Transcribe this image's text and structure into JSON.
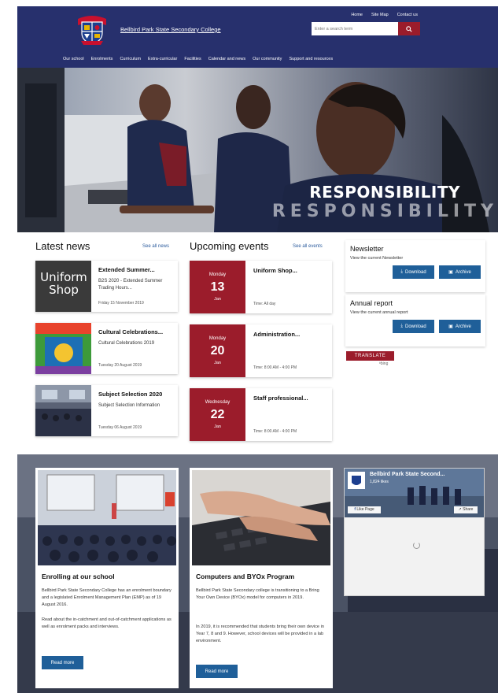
{
  "header": {
    "school_name": "Bellbird Park State Secondary College",
    "top_links": [
      "Home",
      "Site Map",
      "Contact us"
    ],
    "search_placeholder": "Enter a search term",
    "nav": [
      "Our school",
      "Enrolments",
      "Curriculum",
      "Extra-curricular",
      "Facilities",
      "Calendar and news",
      "Our community",
      "Support and resources"
    ]
  },
  "hero": {
    "headline": "RESPONSIBILITY",
    "headline_shadow": "RESPONSIBILITY"
  },
  "news": {
    "title": "Latest news",
    "see_all": "See all news",
    "items": [
      {
        "title": "Extended Summer...",
        "desc": "B2S 2020 - Extended Summer Trading Hours...",
        "date": "Friday 15 November 2019",
        "thumb_text": "Uniform Shop"
      },
      {
        "title": "Cultural Celebrations...",
        "desc": "Cultural Celebrations 2019",
        "date": "Tuesday 20 August 2019"
      },
      {
        "title": "Subject Selection 2020",
        "desc": "Subject Selection Information",
        "date": "Tuesday 06 August 2019"
      }
    ]
  },
  "events": {
    "title": "Upcoming events",
    "see_all": "See all events",
    "items": [
      {
        "day": "Monday",
        "num": "13",
        "month": "Jan",
        "title": "Uniform Shop...",
        "time": "Time: All day"
      },
      {
        "day": "Monday",
        "num": "20",
        "month": "Jan",
        "title": "Administration...",
        "time": "Time: 8:00 AM - 4:00 PM"
      },
      {
        "day": "Wednesday",
        "num": "22",
        "month": "Jan",
        "title": "Staff professional...",
        "time": "Time: 8:00 AM - 4:00 PM"
      }
    ]
  },
  "newsletter": {
    "title": "Newsletter",
    "desc": "View the current Newsletter",
    "download": "Download",
    "archive": "Archive"
  },
  "annual_report": {
    "title": "Annual report",
    "desc": "View the current annual report",
    "download": "Download",
    "archive": "Archive"
  },
  "translate": {
    "label": "TRANSLATE",
    "by": "bing"
  },
  "promos": [
    {
      "title": "Enrolling at our school",
      "p1": "Bellbird Park State Secondary College has an enrolment boundary and a legislated Enrolment Management Plan (EMP) as of 19 August 2016.",
      "p2": "Read about the in-catchment and out-of-catchment applications as well as enrolment packs and interviews.",
      "button": "Read more"
    },
    {
      "title": "Computers and BYOx Program",
      "p1": "Bellbird Park State Secondary college is transitioning to a Bring Your Own Device (BYOx) model for computers in 2019.",
      "p2": "In 2019, it is recommended that students bring their own device in Year 7, 8 and 9. However, school devices will be provided in a lab environment.",
      "button": "Read more"
    }
  ],
  "facebook": {
    "page_name": "Bellbird Park State Second...",
    "likes": "1,824 likes",
    "like_page": "Like Page",
    "share": "Share"
  },
  "colors": {
    "navy": "#27306d",
    "maroon": "#9b1c2b",
    "button_blue": "#1f5f99"
  }
}
